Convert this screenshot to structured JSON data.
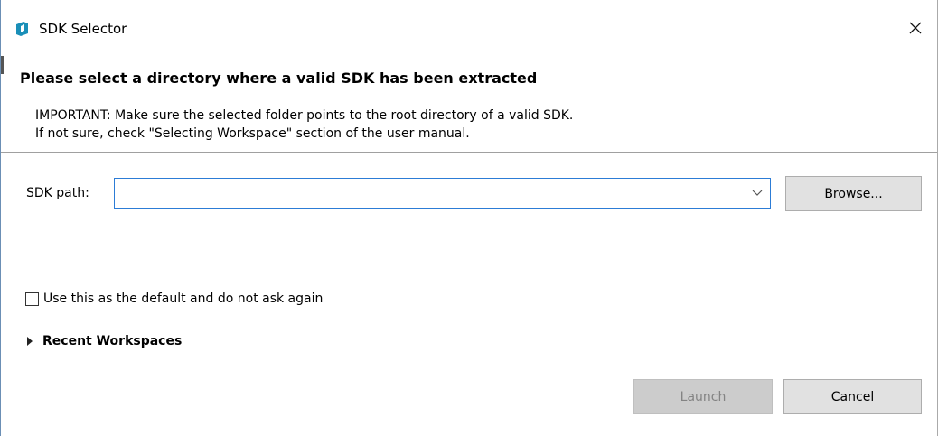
{
  "window": {
    "title": "SDK Selector",
    "icon": "sdk-app-icon",
    "close_icon": "close-icon"
  },
  "header": {
    "title": "Please select a directory where a valid SDK has been extracted",
    "description_line1": "IMPORTANT: Make sure the selected folder points to the root directory of a valid SDK.",
    "description_line2": "If not sure, check \"Selecting Workspace\" section of the user manual."
  },
  "form": {
    "sdk_path_label": "SDK path:",
    "sdk_path_value": "",
    "sdk_path_placeholder": "",
    "browse_label": "Browse...",
    "default_checkbox_label": "Use this as the default and do not ask again",
    "default_checkbox_checked": false,
    "recent_workspaces_label": "Recent Workspaces",
    "recent_workspaces_expanded": false
  },
  "footer": {
    "launch_label": "Launch",
    "launch_enabled": false,
    "cancel_label": "Cancel"
  },
  "colors": {
    "accent_focus_border": "#2c7cd6",
    "button_bg": "#e1e1e1",
    "disabled_button_bg": "#cccccc",
    "icon_teal": "#1a8fb8"
  }
}
